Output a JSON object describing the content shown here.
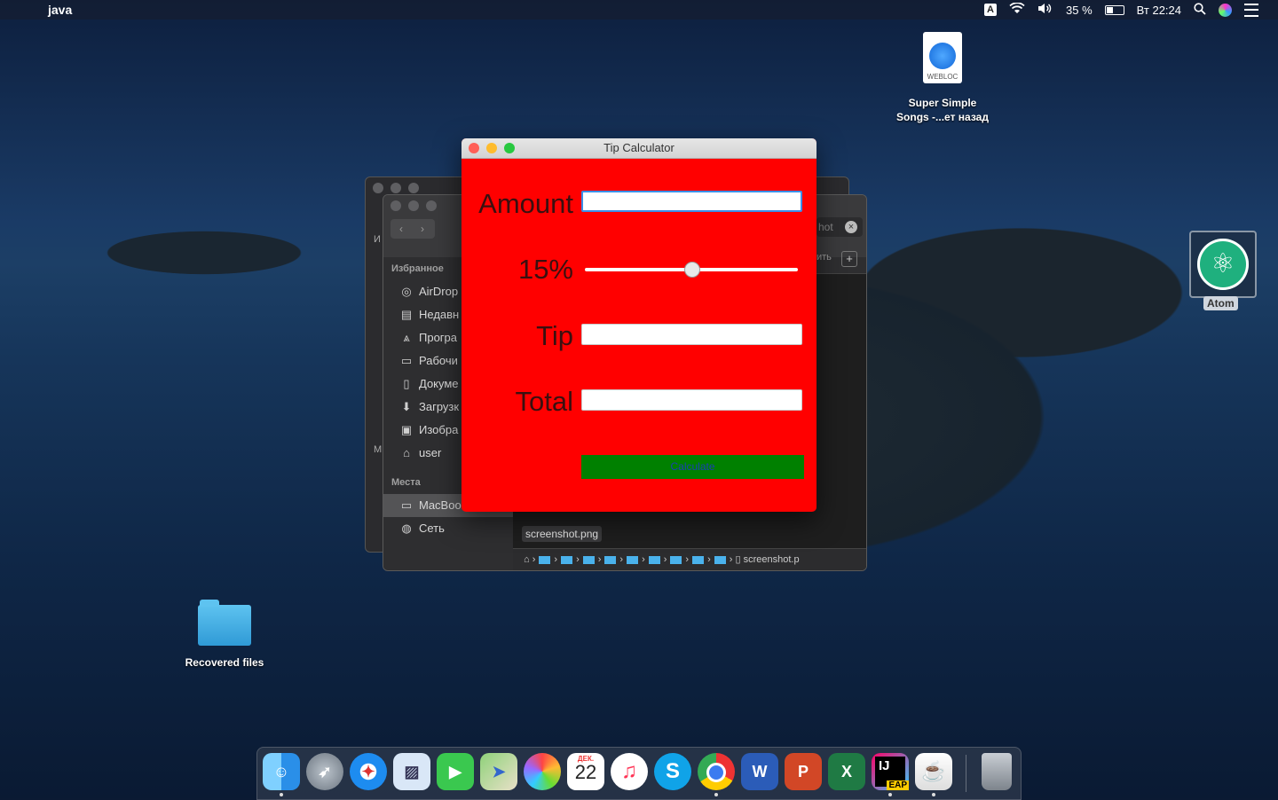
{
  "menubar": {
    "app_name": "java",
    "battery": "35 %",
    "clock": "Вт 22:24",
    "input_source": "A"
  },
  "desktop": {
    "webloc": {
      "tag": "WEBLOC",
      "line1": "Super Simple",
      "line2": "Songs -...ет назад"
    },
    "folder": {
      "label": "Recovered files"
    },
    "atom": {
      "label": "Atom"
    }
  },
  "finder": {
    "sidebar_favorites_header": "Избранное",
    "favorites": [
      {
        "label": "AirDrop",
        "icon": "airdrop-icon"
      },
      {
        "label": "Недавн",
        "icon": "recents-icon"
      },
      {
        "label": "Програ",
        "icon": "applications-icon"
      },
      {
        "label": "Рабочи",
        "icon": "desktop-icon"
      },
      {
        "label": "Докуме",
        "icon": "documents-icon"
      },
      {
        "label": "Загрузк",
        "icon": "downloads-icon"
      },
      {
        "label": "Изобра",
        "icon": "pictures-icon"
      },
      {
        "label": "user",
        "icon": "home-icon"
      }
    ],
    "sidebar_places_header": "Места",
    "places": [
      {
        "label": "MacBoo",
        "icon": "laptop-icon"
      },
      {
        "label": "Сеть",
        "icon": "network-icon"
      }
    ],
    "search_text": "hot",
    "toolbar_partial": "ить",
    "back_window_letter_1": "И",
    "back_window_letter_2": "М",
    "selected_file": "screenshot.png",
    "path_end": "screenshot.p"
  },
  "tip_calculator": {
    "title": "Tip Calculator",
    "amount_label": "Amount",
    "amount_value": "",
    "percent_label": "15%",
    "slider_value": 0.5,
    "tip_label": "Tip",
    "tip_value": "",
    "total_label": "Total",
    "total_value": "",
    "calculate_label": "Calculate"
  },
  "dock": {
    "items": [
      "Finder",
      "Launchpad",
      "Safari",
      "Preview",
      "FaceTime",
      "Maps",
      "Photos",
      "Calendar",
      "iTunes",
      "Skype",
      "Chrome",
      "Word",
      "PowerPoint",
      "Excel",
      "IntelliJ IDEA EAP",
      "Java",
      "Trash"
    ],
    "calendar_month": "ДЕК.",
    "calendar_day": "22",
    "eap_badge": "EAP"
  },
  "colors": {
    "tip_background": "#ff0000",
    "calculate_button": "#008000"
  }
}
